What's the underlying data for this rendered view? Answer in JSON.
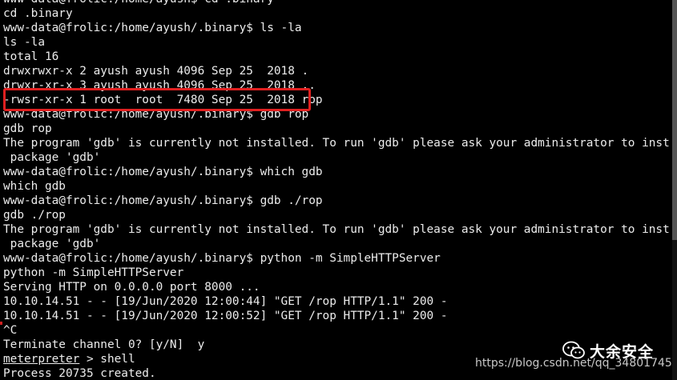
{
  "terminal": {
    "lines": [
      "www-data@frolic:/home/ayush$ cd .binary",
      "cd .binary",
      "www-data@frolic:/home/ayush/.binary$ ls -la",
      "ls -la",
      "total 16",
      "drwxrwxr-x 2 ayush ayush 4096 Sep 25  2018 .",
      "drwxr-xr-x 3 ayush ayush 4096 Sep 25  2018 ..",
      "-rwsr-xr-x 1 root  root  7480 Sep 25  2018 rop",
      "www-data@frolic:/home/ayush/.binary$ gdb rop",
      "gdb rop",
      "The program 'gdb' is currently not installed. To run 'gdb' please ask your administrator to install the",
      " package 'gdb'",
      "www-data@frolic:/home/ayush/.binary$ which gdb",
      "which gdb",
      "www-data@frolic:/home/ayush/.binary$ gdb ./rop",
      "gdb ./rop",
      "The program 'gdb' is currently not installed. To run 'gdb' please ask your administrator to install the",
      " package 'gdb'",
      "www-data@frolic:/home/ayush/.binary$ python -m SimpleHTTPServer",
      "python -m SimpleHTTPServer",
      "Serving HTTP on 0.0.0.0 port 8000 ...",
      "10.10.14.51 - - [19/Jun/2020 12:00:44] \"GET /rop HTTP/1.1\" 200 -",
      "10.10.14.51 - - [19/Jun/2020 12:00:52] \"GET /rop HTTP/1.1\" 200 -",
      "^C",
      "Terminate channel 0? [y/N]  y"
    ],
    "meterpreter_prompt": "meterpreter",
    "meterpreter_command": " > shell",
    "last_line": "Process 20735 created."
  },
  "watermark": {
    "badge_label": "大余安全",
    "url": "https://blog.csdn.net/qq_34801745"
  },
  "colors": {
    "background": "#000000",
    "foreground": "#ececec",
    "highlight": "#e02020"
  },
  "icons": {
    "badge": "wechat-icon"
  }
}
